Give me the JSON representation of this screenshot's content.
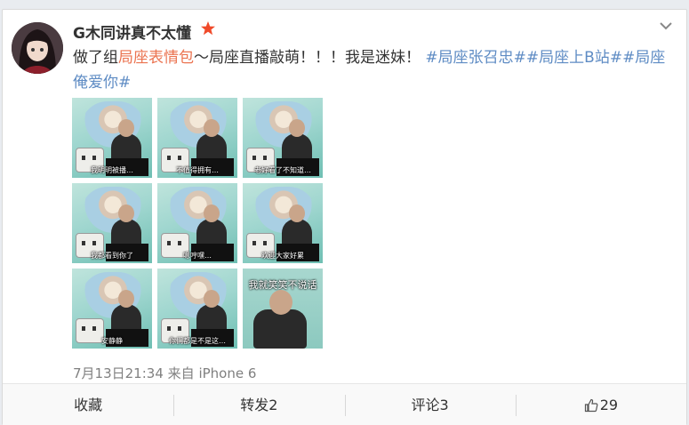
{
  "post": {
    "username": "G木同讲真不太懂",
    "text_before": "做了组",
    "highlight": "局座表情包",
    "text_after": "～局座直播敲萌！！！我是迷妹！",
    "tags": [
      "#局座张召忠#",
      "#局座上B站#",
      "#局座俺爱你#"
    ],
    "timestamp": "7月13日21:34",
    "source_prefix": "来自",
    "source_device": "iPhone 6"
  },
  "images": [
    {
      "caption": "我明明被播…",
      "style": "studio"
    },
    {
      "caption": "不值得拥有…",
      "style": "studio"
    },
    {
      "caption": "老好看了不知道…",
      "style": "studio"
    },
    {
      "caption": "我都看到你了",
      "style": "studio"
    },
    {
      "caption": "嗯哼嘿…",
      "style": "studio"
    },
    {
      "caption": "欢迎大家好累",
      "style": "studio"
    },
    {
      "caption": "安静静",
      "style": "studio"
    },
    {
      "caption": "你们都是不是这…",
      "style": "studio"
    },
    {
      "caption": "我就笑笑不说话",
      "style": "close"
    }
  ],
  "actions": {
    "favorite": "收藏",
    "repost": "转发2",
    "comment": "评论3",
    "like_count": "29"
  },
  "colors": {
    "accent_orange": "#eb7350",
    "tag_blue": "#5f8cc4",
    "badge_red": "#f04a2a"
  },
  "icons": {
    "badge": "star-badge-icon",
    "menu": "chevron-down-icon",
    "like": "thumbs-up-icon"
  }
}
